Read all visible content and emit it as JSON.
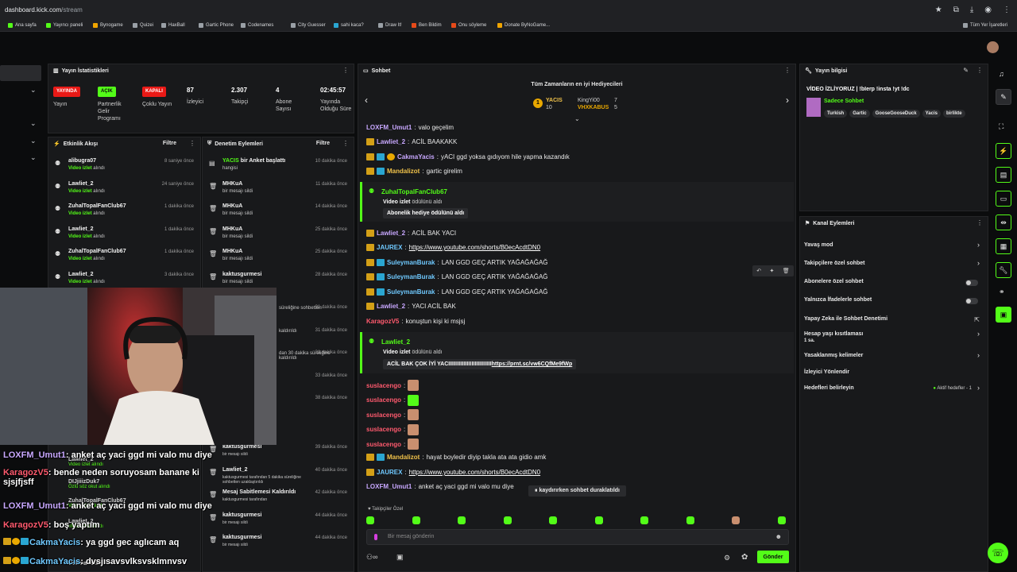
{
  "browser": {
    "url_host": "dashboard.kick.com",
    "url_path": "/stream",
    "all_bookmarks": "Tüm Yer İşaretleri"
  },
  "bookmarks": [
    {
      "label": "Ana sayfa",
      "color": "#53fc18"
    },
    {
      "label": "Yayıncı paneli",
      "color": "#53fc18"
    },
    {
      "label": "Bynogame",
      "color": "#f0a500"
    },
    {
      "label": "Quizei",
      "color": "#9aa0a6"
    },
    {
      "label": "HaxBall",
      "color": "#9aa0a6"
    },
    {
      "label": "Gartic Phone",
      "color": "#9aa0a6"
    },
    {
      "label": "Codenames",
      "color": "#9aa0a6"
    },
    {
      "label": "City Guesser",
      "color": "#9aa0a6"
    },
    {
      "label": "sahi kaca?",
      "color": "#2aa6d1"
    },
    {
      "label": "Draw It!",
      "color": "#9aa0a6"
    },
    {
      "label": "Ben Bildim",
      "color": "#e64a19"
    },
    {
      "label": "Onu söyleme",
      "color": "#e64a19"
    },
    {
      "label": "Donate ByNoGame...",
      "color": "#f0a500"
    }
  ],
  "stats": {
    "title": "Yayın İstatistikleri",
    "live_pill": "YAYINDA",
    "live_label": "Yayın",
    "partner_pill": "AÇIK",
    "partner_label": "Partnerlik Gelir Programı",
    "multi_pill": "KAPALI",
    "multi_label": "Çoklu Yayın",
    "viewers": "87",
    "viewers_label": "İzleyici",
    "followers": "2.307",
    "followers_label": "Takipçi",
    "subs": "4",
    "subs_label": "Abone Sayısı",
    "uptime": "02:45:57",
    "uptime_label": "Yayında Olduğu Süre"
  },
  "activity": {
    "title": "Etkinlik Akışı",
    "filter": "Filtre",
    "items": [
      {
        "user": "alibugra07",
        "action": "Video izlet",
        "suffix": "alındı",
        "time": "8 saniye önce"
      },
      {
        "user": "Lawliet_2",
        "action": "Video izlet",
        "suffix": "alındı",
        "time": "24 saniye önce"
      },
      {
        "user": "ZuhalTopalFanClub67",
        "action": "Video izlet",
        "suffix": "alındı",
        "time": "1 dakika önce"
      },
      {
        "user": "Lawliet_2",
        "action": "Video izlet",
        "suffix": "alındı",
        "time": "1 dakika önce"
      },
      {
        "user": "ZuhalTopalFanClub67",
        "action": "Video izlet",
        "suffix": "alındı",
        "time": "1 dakika önce"
      },
      {
        "user": "Lawliet_2",
        "action": "Video izlet",
        "suffix": "alındı",
        "time": "3 dakika önce"
      }
    ]
  },
  "moderation": {
    "title": "Denetim Eylemleri",
    "filter": "Filtre",
    "items": [
      {
        "user": "YACIS",
        "text": "bir Anket başlattı",
        "sub": "hangisi",
        "time": "10 dakika önce"
      },
      {
        "user": "MHKuA",
        "text": "",
        "sub": "bir mesajı sildi",
        "time": "11 dakika önce"
      },
      {
        "user": "MHKuA",
        "text": "",
        "sub": "bir mesajı sildi",
        "time": "14 dakika önce"
      },
      {
        "user": "MHKuA",
        "text": "",
        "sub": "bir mesajı sildi",
        "time": "25 dakika önce"
      },
      {
        "user": "MHKuA",
        "text": "",
        "sub": "bir mesajı sildi",
        "time": "25 dakika önce"
      },
      {
        "user": "kaktusgurmesi",
        "text": "",
        "sub": "bir mesajı sildi",
        "time": "28 dakika önce"
      }
    ],
    "lower": [
      {
        "user": "kaktusgurmesi",
        "sub": "bir mesajı sildi",
        "time": "39 dakika önce"
      },
      {
        "user": "Lawliet_2",
        "sub": "kaktusgurmesi tarafından 5 dakika süreliğine sohbetten uzaklaştırıldı",
        "time": "40 dakika önce"
      },
      {
        "user": "Mesaj Sabitlemesi Kaldırıldı",
        "sub": "kaktusgurmesi tarafından",
        "time": "42 dakika önce"
      },
      {
        "user": "kaktusgurmesi",
        "sub": "bir mesajı sildi",
        "time": "44 dakika önce"
      },
      {
        "user": "kaktusgurmesi",
        "sub": "bir mesajı sildi",
        "time": "44 dakika önce"
      }
    ],
    "partial": [
      {
        "text": "süreliğine sohbetten",
        "time": "31 dakika önce"
      },
      {
        "text": "kaldırıldı",
        "time": "31 dakika önce"
      },
      {
        "text": "dan 30 dakika süreliğine kaldırıldı",
        "time": "31 dakika önce"
      },
      {
        "text": "",
        "time": "33 dakika önce"
      },
      {
        "text": "",
        "time": "38 dakika önce"
      }
    ]
  },
  "chat": {
    "title": "Sohbet",
    "gifters_title": "Tüm Zamanların en iyi Hediyecileri",
    "gifters": [
      {
        "name": "YACIS",
        "count": "10"
      },
      {
        "name": "KingYi00",
        "count": "7"
      },
      {
        "name": "VHXKABUS",
        "count": "5"
      }
    ],
    "messages": [
      {
        "user": "LOXFM_Umut1",
        "color": "#c8a8ff",
        "text": "valo geçelim",
        "badges": 0
      },
      {
        "user": "Lawliet_2",
        "color": "#c8a8ff",
        "text": "ACİL BAAKAKK",
        "badges": 1
      },
      {
        "user": "CakmaYacis",
        "color": "#c8a8ff",
        "text": "yACI ggd yoksa gıdıyom hile yapma kazandık",
        "badges": 3
      },
      {
        "user": "Mandalizot",
        "color": "#f0c24a",
        "text": "gartic girelim",
        "badges": 2
      }
    ],
    "gift1": {
      "user": "ZuhalTopalFanClub67",
      "action": "Video izlet",
      "suffix": "ödülünü aldı",
      "box": "Abonelik hediye ödülünü aldı"
    },
    "messages2": [
      {
        "user": "Lawliet_2",
        "color": "#c8a8ff",
        "text": "ACİL BAK YACI",
        "link": "",
        "badges": 1
      },
      {
        "user": "JAUREX",
        "color": "#6fc9ff",
        "text": "",
        "link": "https://www.youtube.com/shorts/B0ecAcdtDN0",
        "badges": 1
      },
      {
        "user": "SuleymanBurak",
        "color": "#6fc9ff",
        "text": "LAN GGD GEÇ ARTIK YAĞAĞAĞAĞ",
        "link": "",
        "badges": 2
      },
      {
        "user": "SuleymanBurak",
        "color": "#6fc9ff",
        "text": "LAN GGD GEÇ ARTIK YAĞAĞAĞAĞ",
        "link": "",
        "badges": 2
      },
      {
        "user": "SuleymanBurak",
        "color": "#6fc9ff",
        "text": "LAN GGD GEÇ ARTIK YAĞAĞAĞAĞ",
        "link": "",
        "badges": 2
      },
      {
        "user": "Lawliet_2",
        "color": "#c8a8ff",
        "text": "YACI ACİL BAK",
        "link": "",
        "badges": 1
      },
      {
        "user": "KaragozV5",
        "color": "#ff5a6e",
        "text": "konuştun kişi ki msjsj",
        "link": "",
        "badges": 0
      }
    ],
    "gift2": {
      "user": "Lawliet_2",
      "action": "Video izlet",
      "suffix": "ödülünü aldı",
      "box": "ACİL BAK ÇOK İYİ YACIIIIIIIIIIIIIIIIIIIIIIIIIIII",
      "box_link": "https://prnt.sc/vw6CQfMe9fWp"
    },
    "emotes": [
      {
        "user": "suslacengo"
      },
      {
        "user": "suslacengo"
      },
      {
        "user": "suslacengo"
      },
      {
        "user": "suslacengo"
      },
      {
        "user": "suslacengo"
      }
    ],
    "messages3": [
      {
        "user": "Mandalizot",
        "color": "#f0c24a",
        "text": "hayat boyledir diyip takla ata ata gidio amk",
        "link": "",
        "badges": 2
      },
      {
        "user": "JAUREX",
        "color": "#6fc9ff",
        "text": "",
        "link": "https://www.youtube.com/shorts/B0ecAcdtDN0",
        "badges": 1
      },
      {
        "user": "LOXFM_Umut1",
        "color": "#c8a8ff",
        "text": "anket aç yaci ggd mi valo mu diye",
        "link": "",
        "badges": 0
      }
    ],
    "paused": "kaydırırken sohbet duraklatıldı",
    "followers_only": "Takipçiler Özel",
    "placeholder": "Bir mesaj gönderin",
    "send": "Gönder"
  },
  "info": {
    "title": "Yayın bilgisi",
    "stream_title": "VİDEO İZLİYORUZ | !bIerp !insta !yt !dc",
    "category": "Sadece Sohbet",
    "tags": [
      "Turkish",
      "Gartic",
      "GooseGooseDuck",
      "Yacis",
      "birlikte"
    ]
  },
  "actions": {
    "title": "Kanal Eylemleri",
    "items": [
      {
        "label": "Yavaş mod",
        "type": "arrow",
        "sub": ""
      },
      {
        "label": "Takipçilere özel sohbet",
        "type": "arrow",
        "sub": ""
      },
      {
        "label": "Abonelere özel sohbet",
        "type": "toggle",
        "sub": ""
      },
      {
        "label": "Yalnızca İfadelerle sohbet",
        "type": "toggle",
        "sub": ""
      },
      {
        "label": "Yapay Zeka ile Sohbet Denetimi",
        "type": "ext",
        "sub": ""
      },
      {
        "label": "Hesap yaşı kısıtlaması",
        "type": "arrow",
        "sub": "1 sa."
      },
      {
        "label": "Yasaklanmış kelimeler",
        "type": "arrow",
        "sub": ""
      },
      {
        "label": "İzleyici Yönlendir",
        "type": "none",
        "sub": ""
      },
      {
        "label": "Hedefleri belirleyin",
        "type": "goal",
        "sub": "",
        "goal": "Aktif hedefler - 1"
      }
    ]
  },
  "overlay": [
    {
      "user": "LOXFM_Umut1",
      "text": "anket aç yaci ggd mi valo mu diye",
      "cls": "n1"
    },
    {
      "user": "KaragozV5",
      "text": "bende neden soruyosam banane ki sjsjfjsff",
      "cls": "n2"
    },
    {
      "user": "LOXFM_Umut1",
      "text": "anket aç yaci ggd mi valo mu diye",
      "cls": "n1"
    },
    {
      "user": "KaragozV5",
      "text": "boş yaptım",
      "cls": "n2"
    },
    {
      "user": "CakmaYacis",
      "text": "ya ggd gec aglıcam aq",
      "cls": "n3"
    },
    {
      "user": "CakmaYacis",
      "text": "dvsjısavsvlksvsklmnvsv",
      "cls": "n3"
    }
  ],
  "overlay_under": [
    {
      "user": "Lawliet_2",
      "sub": "Video izlet alındı"
    },
    {
      "user": "DIJjiiizDuk7",
      "sub": "Özlü söz okut alındı"
    },
    {
      "user": "ZuhalTopalFanClub67",
      "sub": "Video izlet alındı"
    },
    {
      "user": "Lawliet_2",
      "sub": "Video izlet alındı"
    },
    {
      "user": "CakmaYacis",
      "sub": ""
    }
  ]
}
